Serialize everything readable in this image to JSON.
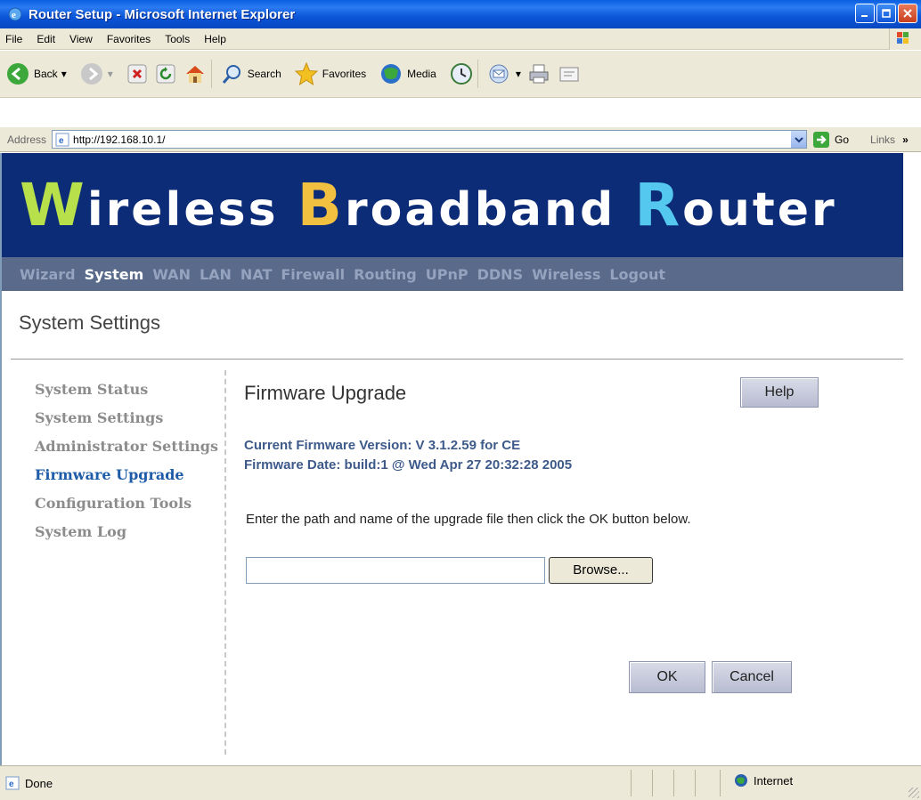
{
  "window": {
    "title": "Router Setup - Microsoft Internet Explorer"
  },
  "menu": {
    "items": [
      "File",
      "Edit",
      "View",
      "Favorites",
      "Tools",
      "Help"
    ]
  },
  "toolbar": {
    "back": "Back",
    "search": "Search",
    "favorites": "Favorites",
    "media": "Media"
  },
  "address": {
    "label": "Address",
    "url": "http://192.168.10.1/",
    "go": "Go",
    "links": "Links"
  },
  "banner": {
    "word1_cap": "W",
    "word1_rest": "ireless",
    "word2_cap": "B",
    "word2_rest": "roadband",
    "word3_cap": "R",
    "word3_rest": "outer"
  },
  "topnav": {
    "items": [
      "Wizard",
      "System",
      "WAN",
      "LAN",
      "NAT",
      "Firewall",
      "Routing",
      "UPnP",
      "DDNS",
      "Wireless",
      "Logout"
    ],
    "active": "System"
  },
  "page": {
    "section_title": "System Settings"
  },
  "sidenav": {
    "items": [
      "System Status",
      "System Settings",
      "Administrator Settings",
      "Firmware Upgrade",
      "Configuration Tools",
      "System Log"
    ],
    "active": "Firmware Upgrade"
  },
  "content": {
    "title": "Firmware Upgrade",
    "help_label": "Help",
    "fw_version": "Current Firmware Version: V 3.1.2.59 for CE",
    "fw_date": "Firmware Date:  build:1 @ Wed Apr 27 20:32:28 2005",
    "instruction": "Enter the path and name of the upgrade file then click the OK button below.",
    "file_value": "",
    "browse_label": "Browse...",
    "ok_label": "OK",
    "cancel_label": "Cancel"
  },
  "status": {
    "text": "Done",
    "zone": "Internet"
  },
  "colors": {
    "banner_bg": "#0d2c78",
    "nav_bg": "#596a8a",
    "nav_active": "#ffffff",
    "nav_inactive": "#95a3bf",
    "cap_w": "#b8e04a",
    "cap_b": "#f2c040",
    "cap_r": "#55c8f0",
    "sidenav_active": "#1f5ca8",
    "firmware_text": "#3d5a8a"
  },
  "icons": [
    "ie-icon",
    "minimize-icon",
    "maximize-icon",
    "close-icon",
    "windows-flag-icon",
    "back-arrow-icon",
    "forward-arrow-icon",
    "stop-icon",
    "refresh-icon",
    "home-icon",
    "search-icon",
    "favorites-star-icon",
    "media-icon",
    "history-icon",
    "mail-icon",
    "print-icon",
    "edit-icon",
    "go-arrow-icon",
    "globe-icon"
  ]
}
